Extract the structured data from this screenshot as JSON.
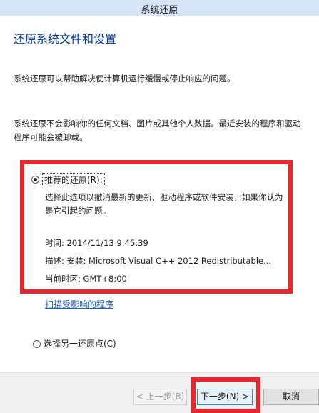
{
  "window": {
    "title": "系统还原"
  },
  "main": {
    "heading": "还原系统文件和设置",
    "intro": "系统还原可以帮助解决使计算机运行缓慢或停止响应的问题。",
    "notice": "系统还原不会影响你的任何文档、图片或其他个人数据。最近安装的程序和驱动程序可能会被卸载。"
  },
  "options": {
    "recommended": {
      "label": "推荐的还原(R):",
      "selected": true,
      "description": "选择此选项以撤消最新的更新、驱动程序或软件安装，如果你认为是它引起的问题。",
      "time": "时间: 2014/11/13 9:45:39",
      "detail": "描述: 安装: Microsoft Visual C++ 2012 Redistributable...",
      "timezone": "当前时区: GMT+8:00"
    },
    "scan_link": "扫描受影响的程序",
    "other": {
      "label": "选择另一还原点(C)",
      "selected": false
    }
  },
  "buttons": {
    "prev": "< 上一步(B)",
    "next": "下一步(N) >",
    "cancel": "取消"
  },
  "colors": {
    "heading": "#003399",
    "link": "#1a5ebf",
    "highlight": "#e8262e",
    "titlebar": "#d7e6f7"
  }
}
